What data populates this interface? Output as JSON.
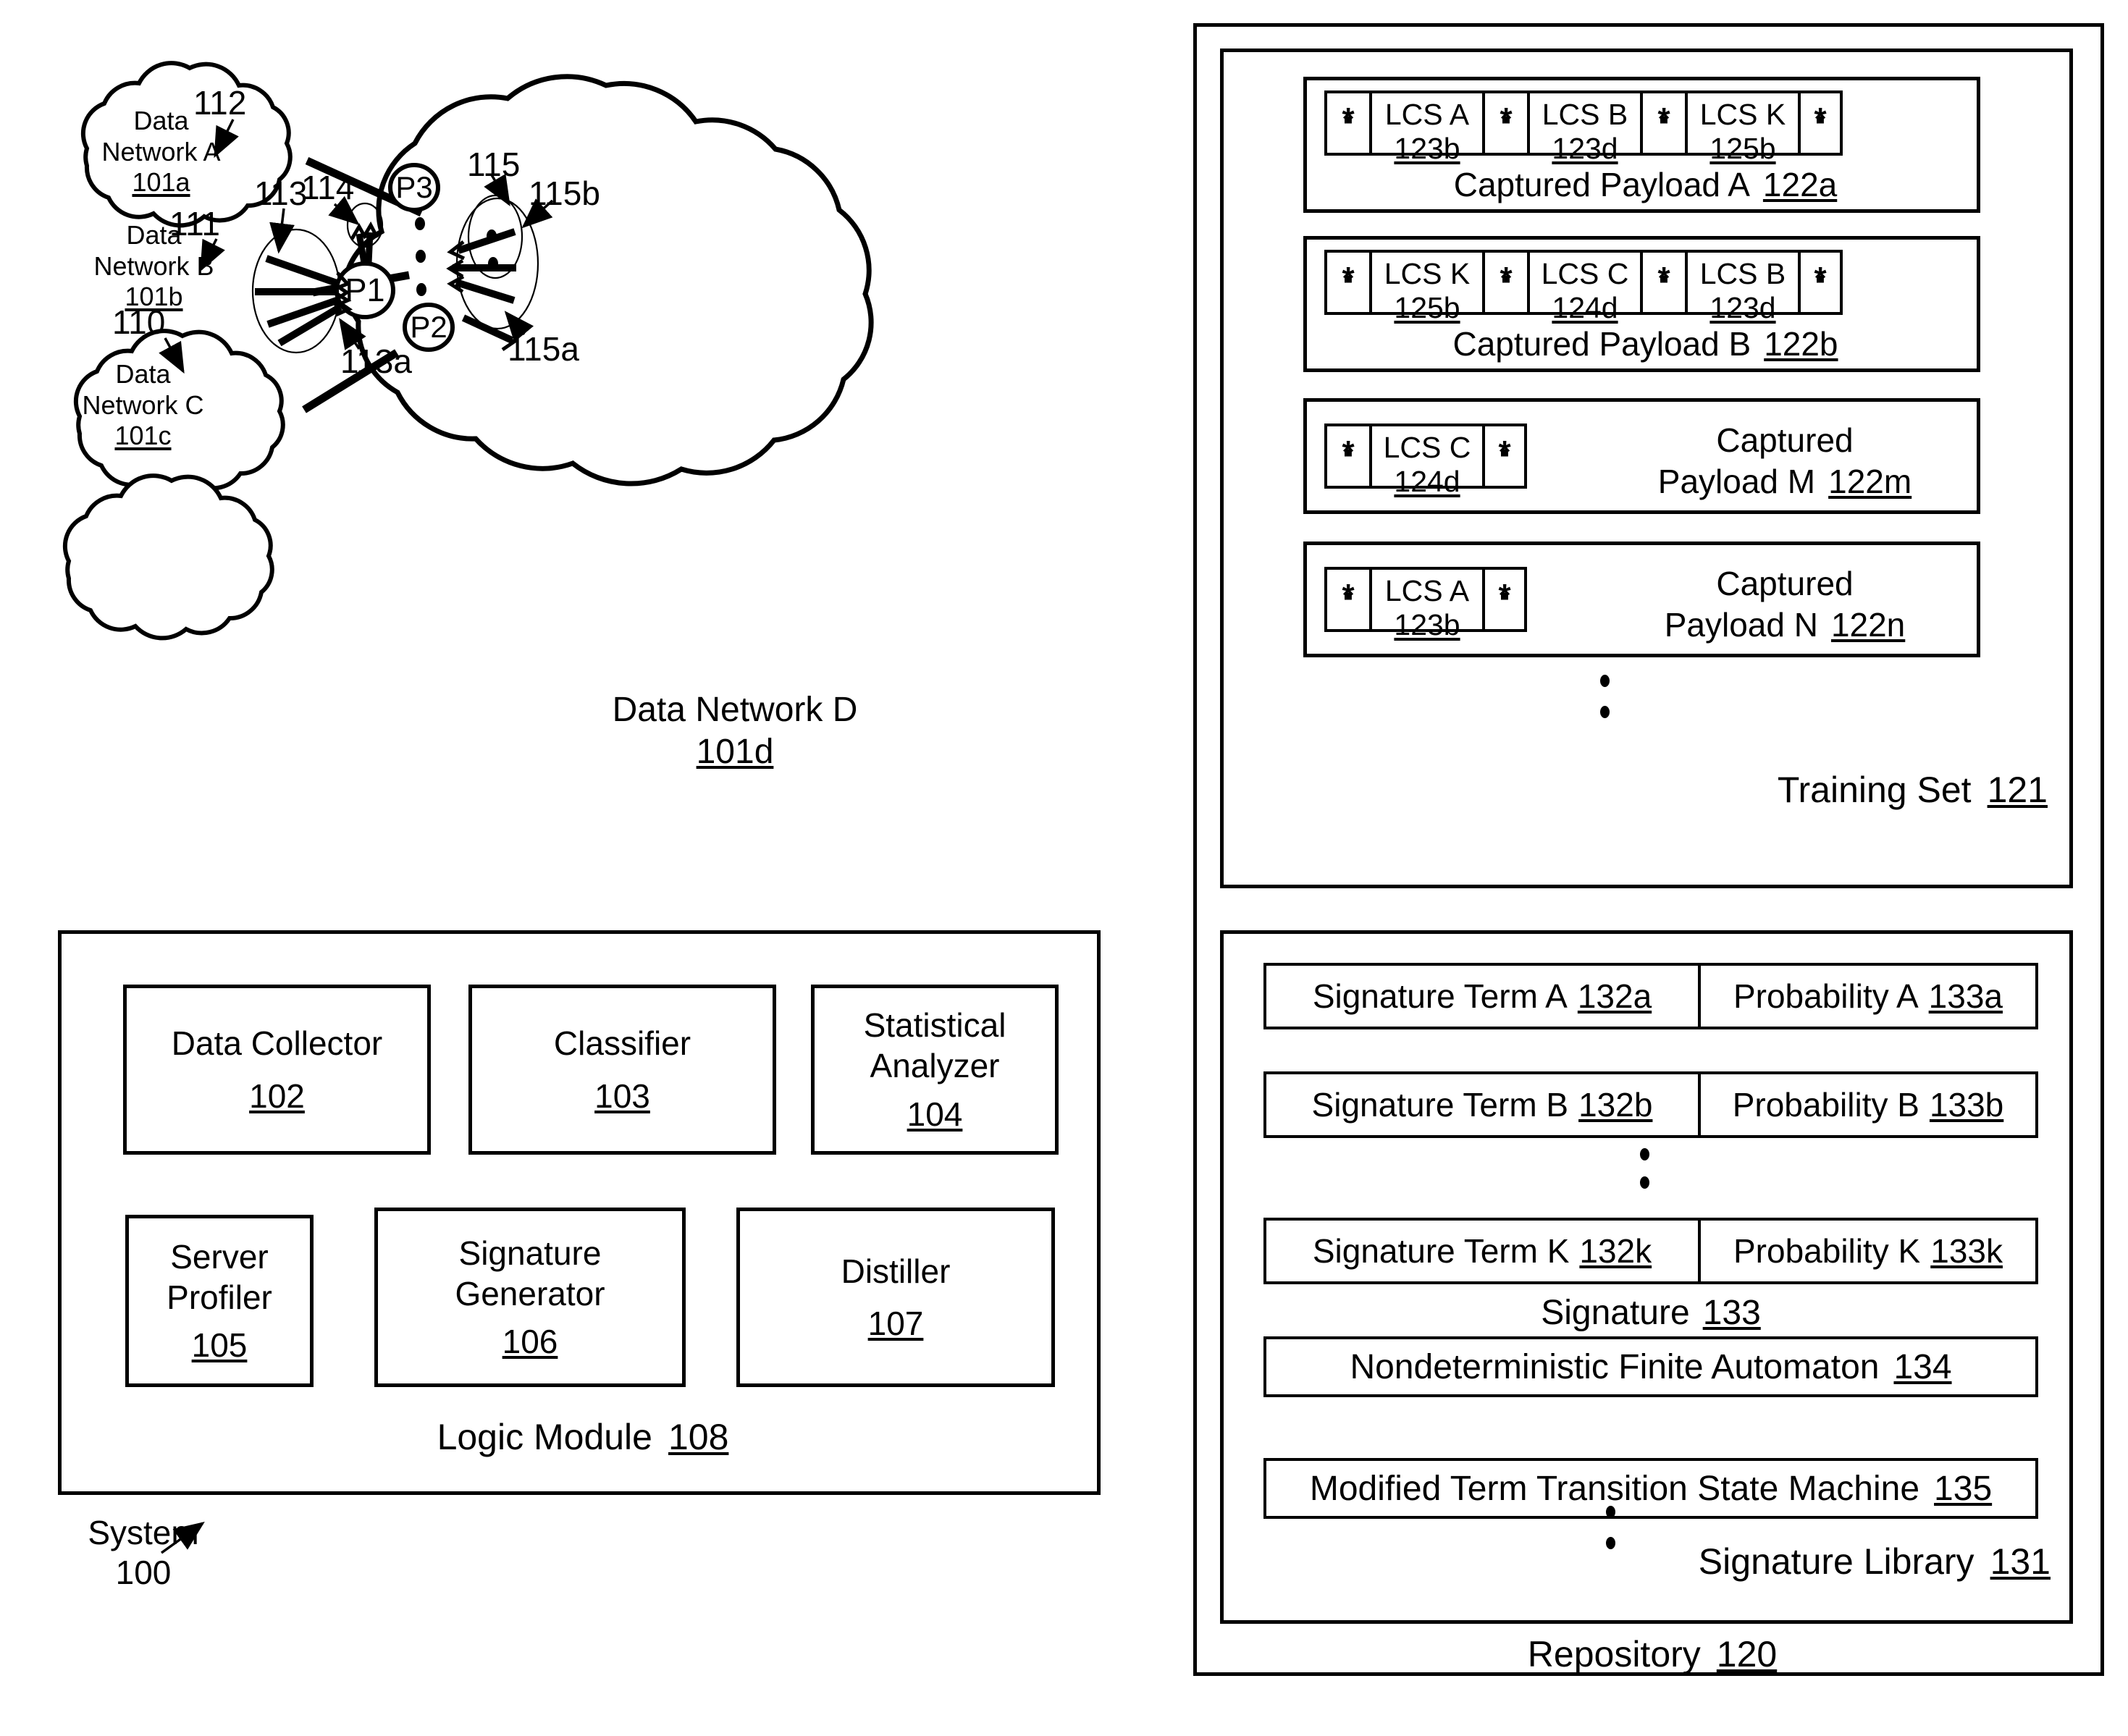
{
  "figure": {
    "system_label": "System",
    "system_ref": "100"
  },
  "networks": {
    "clouds": [
      {
        "name_line1": "Data",
        "name_line2": "Network A",
        "ref": "101a"
      },
      {
        "name_line1": "Data",
        "name_line2": "Network B",
        "ref": "101b"
      },
      {
        "name_line1": "Data",
        "name_line2": "Network C",
        "ref": "101c"
      }
    ],
    "main_cloud": {
      "name": "Data Network D",
      "ref": "101d"
    },
    "link_refs": [
      "110",
      "111",
      "112"
    ],
    "nodes": [
      "P1",
      "P2",
      "P3"
    ],
    "callouts": [
      "113",
      "113a",
      "114",
      "115",
      "115a",
      "115b"
    ]
  },
  "logic_module": {
    "title": "Logic Module",
    "ref": "108",
    "components": [
      {
        "line1": "Data Collector",
        "line2": "",
        "ref": "102"
      },
      {
        "line1": "Classifier",
        "line2": "",
        "ref": "103"
      },
      {
        "line1": "Statistical",
        "line2": "Analyzer",
        "ref": "104"
      },
      {
        "line1": "Server",
        "line2": "Profiler",
        "ref": "105"
      },
      {
        "line1": "Signature",
        "line2": "Generator",
        "ref": "106"
      },
      {
        "line1": "Distiller",
        "line2": "",
        "ref": "107"
      }
    ]
  },
  "repository": {
    "title": "Repository",
    "ref": "120",
    "training_set": {
      "title": "Training Set",
      "ref": "121",
      "payloads": [
        {
          "label": "Captured Payload A",
          "ref": "122a",
          "layout": "inline",
          "cells": [
            {
              "type": "star",
              "star": "*",
              "dot": "▪"
            },
            {
              "type": "lcs",
              "name": "LCS A",
              "ref": "123b"
            },
            {
              "type": "star",
              "star": "*",
              "dot": "▪"
            },
            {
              "type": "lcs",
              "name": "LCS B",
              "ref": "123d"
            },
            {
              "type": "star",
              "star": "*",
              "dot": "▪"
            },
            {
              "type": "lcs",
              "name": "LCS K",
              "ref": "125b"
            },
            {
              "type": "star",
              "star": "*",
              "dot": "▪"
            }
          ]
        },
        {
          "label": "Captured Payload B",
          "ref": "122b",
          "layout": "inline",
          "cells": [
            {
              "type": "star",
              "star": "*",
              "dot": "▪"
            },
            {
              "type": "lcs",
              "name": "LCS K",
              "ref": "125b"
            },
            {
              "type": "star",
              "star": "*",
              "dot": "▪"
            },
            {
              "type": "lcs",
              "name": "LCS C",
              "ref": "124d"
            },
            {
              "type": "star",
              "star": "*",
              "dot": "▪"
            },
            {
              "type": "lcs",
              "name": "LCS B",
              "ref": "123d"
            },
            {
              "type": "star",
              "star": "*",
              "dot": "▪"
            }
          ]
        },
        {
          "label": "Captured",
          "label2": "Payload M",
          "ref": "122m",
          "layout": "side",
          "cells": [
            {
              "type": "star",
              "star": "*",
              "dot": "▪"
            },
            {
              "type": "lcs",
              "name": "LCS C",
              "ref": "124d"
            },
            {
              "type": "star",
              "star": "*",
              "dot": "▪"
            }
          ]
        },
        {
          "label": "Captured",
          "label2": "Payload N",
          "ref": "122n",
          "layout": "side",
          "cells": [
            {
              "type": "star",
              "star": "*",
              "dot": "▪"
            },
            {
              "type": "lcs",
              "name": "LCS A",
              "ref": "123b"
            },
            {
              "type": "star",
              "star": "*",
              "dot": "▪"
            }
          ]
        }
      ]
    },
    "signature_library": {
      "title": "Signature Library",
      "ref": "131",
      "signature": {
        "title": "Signature",
        "ref": "133",
        "rows": [
          {
            "term": "Signature Term A",
            "term_ref": "132a",
            "prob": "Probability A",
            "prob_ref": "133a"
          },
          {
            "term": "Signature Term B",
            "term_ref": "132b",
            "prob": "Probability B",
            "prob_ref": "133b"
          },
          {
            "term": "Signature Term K",
            "term_ref": "132k",
            "prob": "Probability K",
            "prob_ref": "133k"
          }
        ]
      },
      "extra_rows": [
        {
          "label": "Nondeterministic Finite Automaton",
          "ref": "134"
        },
        {
          "label": "Modified Term Transition State Machine",
          "ref": "135"
        }
      ]
    }
  }
}
